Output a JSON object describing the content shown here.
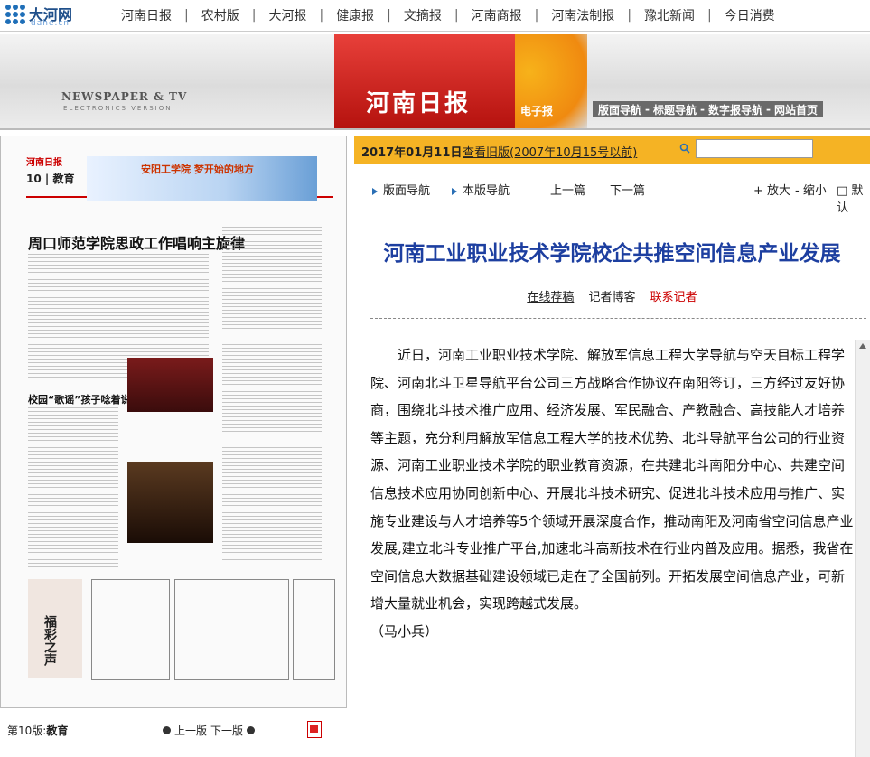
{
  "topnav": {
    "brand": "大河网",
    "brand_sub": "dahe.cn",
    "links": [
      "河南日报",
      "农村版",
      "大河报",
      "健康报",
      "文摘报",
      "河南商报",
      "河南法制报",
      "豫北新闻",
      "今日消费"
    ],
    "separator": "|"
  },
  "banner": {
    "tag_line1": "NEWSPAPER & TV",
    "tag_line2": "ELECTRONICS VERSION",
    "paper_title": "河南日报",
    "edition_label": "电子报",
    "nav": [
      "版面导航",
      "标题导航",
      "数字报导航",
      "网站首页"
    ],
    "nav_sep": "-"
  },
  "page_image": {
    "masthead": "河南日报",
    "edition": "10 | 教育",
    "ad_text": "安阳工学院 梦开始的地方",
    "headline": "周口师范学院思政工作唱响主旋律",
    "subhead": "校园“歌谣”孩子唸着说",
    "column_title": "福彩之声"
  },
  "page_footer": {
    "page_label": "第10版:",
    "page_name": "教育",
    "prev": "上一版",
    "next": "下一版"
  },
  "date_bar": {
    "date": "2017年01月11日",
    "old_link": "查看旧版(2007年10月15号以前)",
    "search_placeholder": ""
  },
  "tools": {
    "page_nav": "版面导航",
    "edition_nav": "本版导航",
    "prev_article": "上一篇",
    "next_article": "下一篇",
    "zoom_in": "+ 放大",
    "zoom_out": "- 缩小",
    "default": "□ 默认"
  },
  "article": {
    "title": "河南工业职业技术学院校企共推空间信息产业发展",
    "submit": "在线荐稿",
    "blog": "记者博客",
    "contact": "联系记者",
    "paragraph": "近日，河南工业职业技术学院、解放军信息工程大学导航与空天目标工程学院、河南北斗卫星导航平台公司三方战略合作协议在南阳签订，三方经过友好协商，围绕北斗技术推广应用、经济发展、军民融合、产教融合、高技能人才培养等主题，充分利用解放军信息工程大学的技术优势、北斗导航平台公司的行业资源、河南工业职业技术学院的职业教育资源，在共建北斗南阳分中心、共建空间信息技术应用协同创新中心、开展北斗技术研究、促进北斗技术应用与推广、实施专业建设与人才培养等5个领域开展深度合作，推动南阳及河南省空间信息产业发展,建立北斗专业推广平台,加速北斗高新技术在行业内普及应用。据悉，我省在空间信息大数据基础建设领域已走在了全国前列。开拓发展空间信息产业，可新增大量就业机会，实现跨越式发展。",
    "author": "（马小兵）"
  },
  "colors": {
    "accent_orange": "#f5b324",
    "title_blue": "#1d3fa0",
    "banner_red": "#c8231e"
  }
}
